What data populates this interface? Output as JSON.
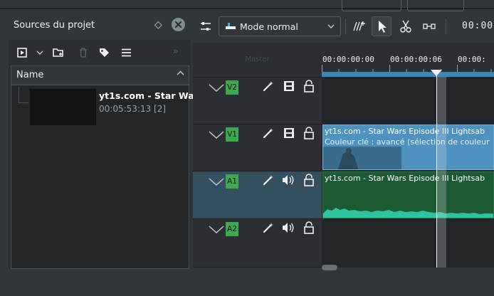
{
  "bin": {
    "title": "Sources du projet",
    "column_name": "Name",
    "item": {
      "name": "yt1s.com - Star Wa",
      "duration": "00:05:53:13 [2]"
    }
  },
  "timeline_toolbar": {
    "mode_label": "Mode normal",
    "timecode": "00:00:"
  },
  "tracks": {
    "master_label": "Master",
    "v2": "V2",
    "v1": "V1",
    "a1": "A1",
    "a2": "A2"
  },
  "ruler": {
    "tc0": "00:00:00:00",
    "tc1": "00:00:00:06",
    "tc2": "00:00:"
  },
  "clips": {
    "video_title": "yt1s.com - Star Wars Episode III Lightsab",
    "video_effect": "Couleur clé : avancé (sélection de couleur",
    "audio_title": "yt1s.com - Star Wars Episode III Lightsab"
  },
  "colors": {
    "video_track": "#4e93c0",
    "audio_track": "#1c5a33",
    "track_badge": "#3daa50",
    "zone_bar": "#3e86b3"
  }
}
